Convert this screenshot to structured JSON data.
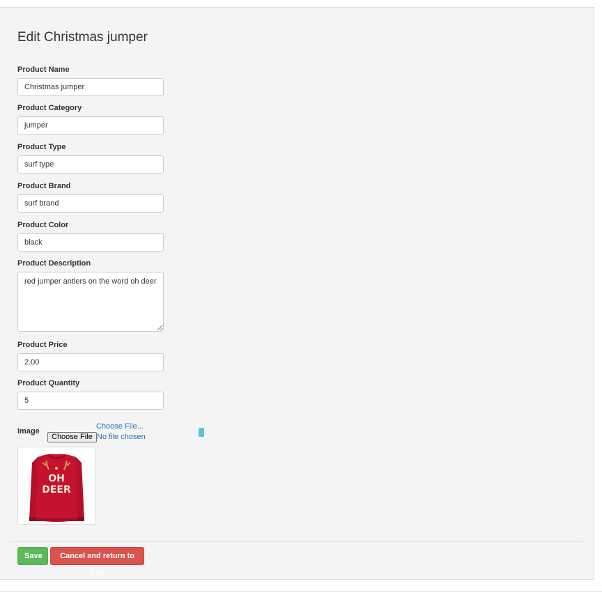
{
  "page": {
    "title": "Edit Christmas jumper"
  },
  "form": {
    "product_name": {
      "label": "Product Name",
      "value": "Christmas jumper"
    },
    "product_category": {
      "label": "Product Category",
      "value": "jumper"
    },
    "product_type": {
      "label": "Product Type",
      "value": "surf type"
    },
    "product_brand": {
      "label": "Product Brand",
      "value": "surf brand"
    },
    "product_color": {
      "label": "Product Color",
      "value": "black"
    },
    "product_description": {
      "label": "Product Description",
      "value": "red jumper antlers on the word oh deer"
    },
    "product_price": {
      "label": "Product Price",
      "value": "2.00"
    },
    "product_quantity": {
      "label": "Product Quantity",
      "value": "5"
    }
  },
  "image": {
    "label": "Image",
    "file_button_label": "Choose File",
    "choose_link": "Choose File...",
    "status": "No file chosen",
    "thumbnail_text": "OH DEER"
  },
  "actions": {
    "save_label": "Save",
    "cancel_label": "Cancel and return to List"
  },
  "colors": {
    "save": "#5cb85c",
    "cancel": "#d9534f",
    "link": "#2a6fb0",
    "progress": "#5bc0de",
    "jumper": "#b3102a"
  }
}
